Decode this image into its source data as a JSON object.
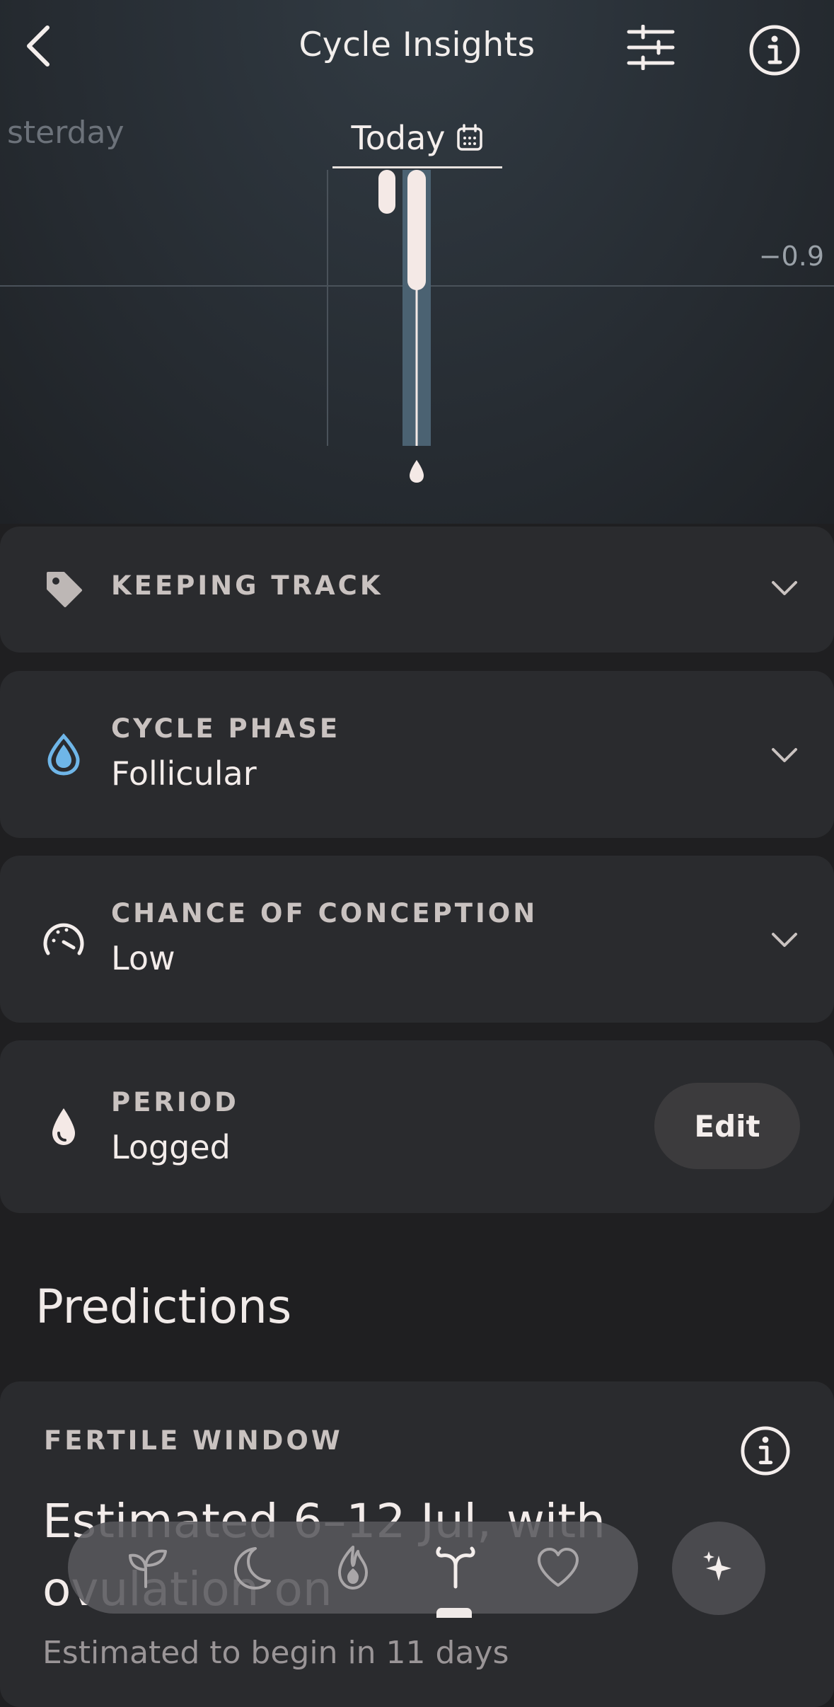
{
  "header": {
    "title": "Cycle Insights"
  },
  "day_tabs": {
    "previous": "sterday",
    "current": "Today"
  },
  "chart": {
    "y_value_label": "−0.9"
  },
  "sections": {
    "keeping_track": {
      "label": "KEEPING TRACK"
    },
    "cycle_phase": {
      "label": "CYCLE PHASE",
      "value": "Follicular"
    },
    "chance_of_conception": {
      "label": "CHANCE OF CONCEPTION",
      "value": "Low"
    },
    "period": {
      "label": "PERIOD",
      "value": "Logged",
      "edit_label": "Edit"
    }
  },
  "predictions": {
    "title": "Predictions",
    "fertile_window": {
      "label": "FERTILE WINDOW",
      "text": "Estimated 6–12 Jul, with ovulation on",
      "subtext": "Estimated to begin in 11 days"
    }
  },
  "nav": {
    "items": [
      "sprout-icon",
      "moon-icon",
      "flame-icon",
      "uterus-icon",
      "heart-icon"
    ],
    "active_index": 3
  },
  "colors": {
    "background": "#1f1f21",
    "card": "#2a2b2e",
    "accent_blue": "#6fb6e8",
    "bar_light": "#f4e9e6",
    "bar_blue": "#4b6272"
  }
}
